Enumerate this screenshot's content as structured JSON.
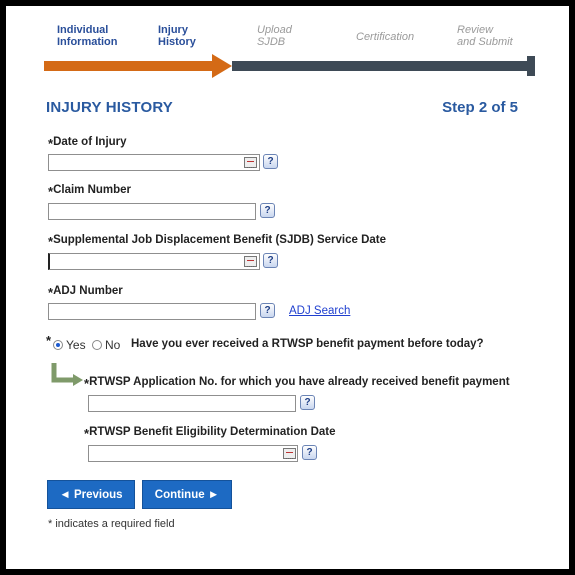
{
  "stepper": {
    "steps": [
      {
        "line1": "Individual",
        "line2": "Information"
      },
      {
        "line1": "Injury",
        "line2": "History"
      },
      {
        "line1": "Upload",
        "line2": "SJDB"
      },
      {
        "line1": "Certification",
        "line2": ""
      },
      {
        "line1": "Review",
        "line2": "and Submit"
      }
    ],
    "completed_color": "#d46a16",
    "remaining_color": "#3e4a56"
  },
  "header": {
    "title": "INJURY HISTORY",
    "step_count": "Step 2 of 5"
  },
  "fields": {
    "date_of_injury": {
      "label": "Date of Injury",
      "value": ""
    },
    "claim_number": {
      "label": "Claim Number",
      "value": ""
    },
    "sjdb_date": {
      "label": "Supplemental Job Displacement Benefit (SJDB) Service Date",
      "value": ""
    },
    "adj_number": {
      "label": "ADJ Number",
      "value": "",
      "link": "ADJ Search"
    },
    "rtwsp_question": {
      "yes": "Yes",
      "no": "No",
      "selected": "Yes",
      "text": "Have you ever received a RTWSP benefit payment before today?"
    },
    "rtwsp_app_no": {
      "label": "RTWSP Application No. for which you have already received benefit payment",
      "value": ""
    },
    "rtwsp_eligibility_date": {
      "label": "RTWSP Benefit Eligibility Determination Date",
      "value": ""
    }
  },
  "common": {
    "required_marker": "*",
    "help_glyph": "?"
  },
  "buttons": {
    "previous": "◄ Previous",
    "continue": "Continue ►"
  },
  "footer": {
    "note": "* indicates a required field"
  }
}
